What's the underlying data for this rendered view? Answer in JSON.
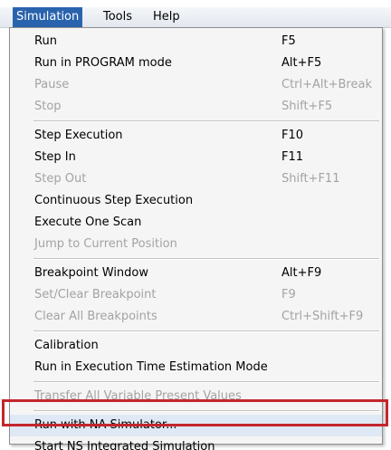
{
  "menubar": {
    "items": [
      "Simulation",
      "Tools",
      "Help"
    ]
  },
  "menu": {
    "groups": [
      {
        "items": [
          {
            "label": "Run",
            "shortcut": "F5",
            "enabled": true
          },
          {
            "label": "Run in PROGRAM mode",
            "shortcut": "Alt+F5",
            "enabled": true
          },
          {
            "label": "Pause",
            "shortcut": "Ctrl+Alt+Break",
            "enabled": false
          },
          {
            "label": "Stop",
            "shortcut": "Shift+F5",
            "enabled": false
          }
        ]
      },
      {
        "items": [
          {
            "label": "Step Execution",
            "shortcut": "F10",
            "enabled": true
          },
          {
            "label": "Step In",
            "shortcut": "F11",
            "enabled": true
          },
          {
            "label": "Step Out",
            "shortcut": "Shift+F11",
            "enabled": false
          },
          {
            "label": "Continuous Step Execution",
            "shortcut": "",
            "enabled": true
          },
          {
            "label": "Execute One Scan",
            "shortcut": "",
            "enabled": true
          },
          {
            "label": "Jump to Current Position",
            "shortcut": "",
            "enabled": false
          }
        ]
      },
      {
        "items": [
          {
            "label": "Breakpoint Window",
            "shortcut": "Alt+F9",
            "enabled": true
          },
          {
            "label": "Set/Clear Breakpoint",
            "shortcut": "F9",
            "enabled": false
          },
          {
            "label": "Clear All Breakpoints",
            "shortcut": "Ctrl+Shift+F9",
            "enabled": false
          }
        ]
      },
      {
        "items": [
          {
            "label": "Calibration",
            "shortcut": "",
            "enabled": true
          },
          {
            "label": "Run in Execution Time Estimation Mode",
            "shortcut": "",
            "enabled": true
          }
        ]
      },
      {
        "items": [
          {
            "label": "Transfer All Variable Present Values",
            "shortcut": "",
            "enabled": false
          }
        ]
      },
      {
        "items": [
          {
            "label": "Run with NA Simulator...",
            "shortcut": "",
            "enabled": true,
            "highlighted": true
          },
          {
            "label": "Start NS Integrated Simulation",
            "shortcut": "",
            "enabled": true
          }
        ]
      }
    ]
  },
  "colors": {
    "active_menu": "#2a63ad",
    "highlight_box": "#c5262d",
    "disabled_text": "#a3a3a3"
  }
}
